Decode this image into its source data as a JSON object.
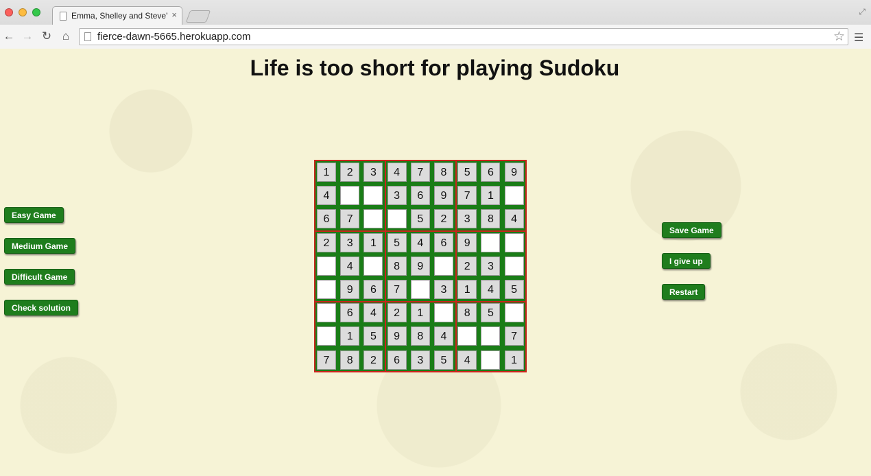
{
  "browser": {
    "tab_title": "Emma, Shelley and Steve's",
    "tab_close": "×",
    "url": "fierce-dawn-5665.herokuapp.com",
    "icons": [
      "back-icon",
      "forward-icon",
      "reload-icon",
      "home-icon",
      "bookmark-star-icon",
      "menu-icon",
      "fullscreen-icon"
    ]
  },
  "page": {
    "title": "Life is too short for playing Sudoku"
  },
  "left_buttons": {
    "easy": "Easy Game",
    "medium": "Medium Game",
    "difficult": "Difficult Game",
    "check": "Check solution"
  },
  "right_buttons": {
    "save": "Save Game",
    "give_up": "I give up",
    "restart": "Restart"
  },
  "colors": {
    "button_green": "#1f7d1d",
    "grid_green": "#1a7d17",
    "box_border_red": "#c9241c",
    "page_background": "#f6f3d6"
  },
  "sudoku": {
    "rows": [
      [
        "1",
        "2",
        "3",
        "4",
        "7",
        "8",
        "5",
        "6",
        "9"
      ],
      [
        "4",
        "",
        "",
        "3",
        "6",
        "9",
        "7",
        "1",
        ""
      ],
      [
        "6",
        "7",
        "",
        "",
        "5",
        "2",
        "3",
        "8",
        "4"
      ],
      [
        "2",
        "3",
        "1",
        "5",
        "4",
        "6",
        "9",
        "",
        ""
      ],
      [
        "",
        "4",
        "",
        "8",
        "9",
        "",
        "2",
        "3",
        ""
      ],
      [
        "",
        "9",
        "6",
        "7",
        "",
        "3",
        "1",
        "4",
        "5"
      ],
      [
        "",
        "6",
        "4",
        "2",
        "1",
        "",
        "8",
        "5",
        ""
      ],
      [
        "",
        "1",
        "5",
        "9",
        "8",
        "4",
        "",
        "",
        "7"
      ],
      [
        "7",
        "8",
        "2",
        "6",
        "3",
        "5",
        "4",
        "",
        "1"
      ]
    ]
  }
}
